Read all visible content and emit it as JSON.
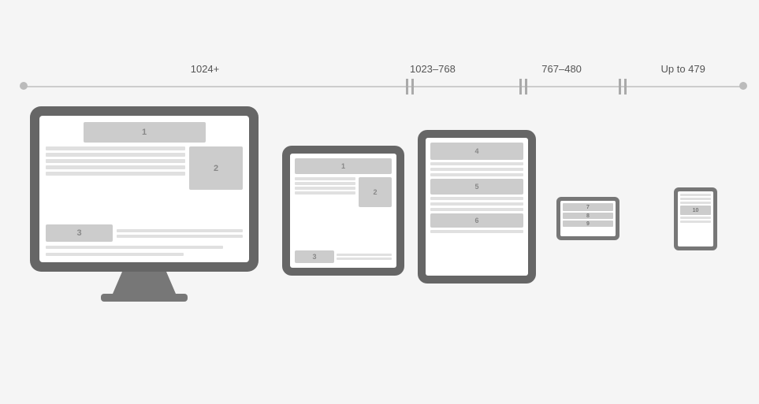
{
  "timeline": {
    "labels": [
      {
        "id": "label-1024",
        "text": "1024+",
        "left": "27%"
      },
      {
        "id": "label-1023",
        "text": "1023–768",
        "left": "57%"
      },
      {
        "id": "label-767",
        "text": "767–480",
        "left": "74%"
      },
      {
        "id": "label-479",
        "text": "Up to 479",
        "left": "90%"
      }
    ]
  },
  "devices": {
    "monitor": {
      "label": "Desktop Monitor",
      "blocks": [
        "1",
        "2",
        "3"
      ]
    },
    "tablet_landscape": {
      "label": "Tablet Landscape",
      "blocks": [
        "1",
        "2",
        "3"
      ]
    },
    "tablet_portrait": {
      "label": "Tablet Portrait",
      "blocks": [
        "4",
        "5",
        "6"
      ]
    },
    "phone_landscape": {
      "label": "Phone Landscape",
      "blocks": [
        "7",
        "8",
        "9"
      ]
    },
    "phone_portrait": {
      "label": "Phone Portrait",
      "blocks": [
        "10"
      ]
    }
  }
}
